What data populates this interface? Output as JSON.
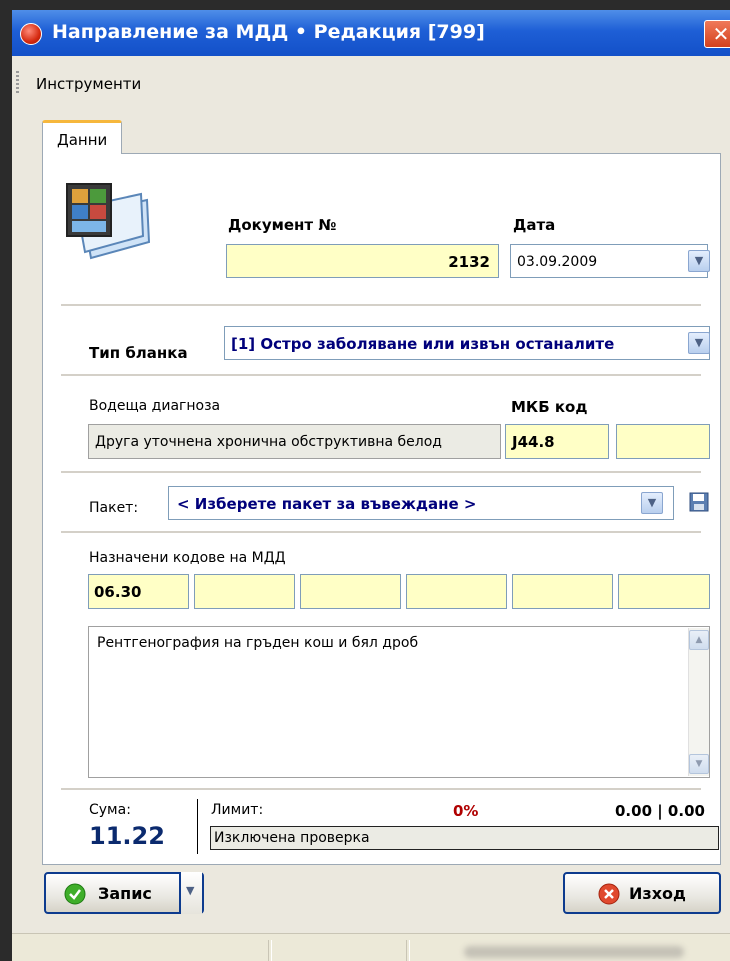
{
  "window": {
    "title": "Направление за МДД • Редакция [799]",
    "close_symbol": "✕"
  },
  "menu": {
    "items": [
      "Инструменти"
    ]
  },
  "tabs": [
    {
      "label": "Данни"
    }
  ],
  "document": {
    "number_label": "Документ №",
    "number_value": "2132",
    "date_label": "Дата",
    "date_value": "03.09.2009"
  },
  "form_type": {
    "label": "Тип бланка",
    "value": "[1] Остро заболяване или извън останалите"
  },
  "diagnosis": {
    "label": "Водеща диагноза",
    "value": "Друга уточнена хронична обструктивна белод",
    "mkb_label": "МКБ код",
    "mkb_code": "J44.8",
    "mkb_code2": ""
  },
  "package": {
    "label": "Пакет:",
    "value": "< Изберете пакет за въвеждане >"
  },
  "codes": {
    "label": "Назначени кодове на МДД",
    "values": [
      "06.30",
      "",
      "",
      "",
      "",
      ""
    ]
  },
  "notes": {
    "text": "Рентгенография на гръден кош и бял дроб"
  },
  "summary": {
    "sum_label": "Сума:",
    "sum_value": "11.22",
    "limit_label": "Лимит:",
    "limit_percent": "0%",
    "limit_values": "0.00 | 0.00",
    "check_status": "Изключена проверка"
  },
  "buttons": {
    "save": "Запис",
    "exit": "Изход"
  },
  "colors": {
    "title_bar": "#1e5fd6",
    "field_bg": "#ffffc6",
    "accent_text": "#00007b",
    "limit_red": "#b00000"
  },
  "icons": {
    "title": "app-icon",
    "document": "document-images-icon",
    "save_package": "floppy-disk-icon",
    "save_button": "green-check-icon",
    "exit_button": "red-x-icon"
  }
}
